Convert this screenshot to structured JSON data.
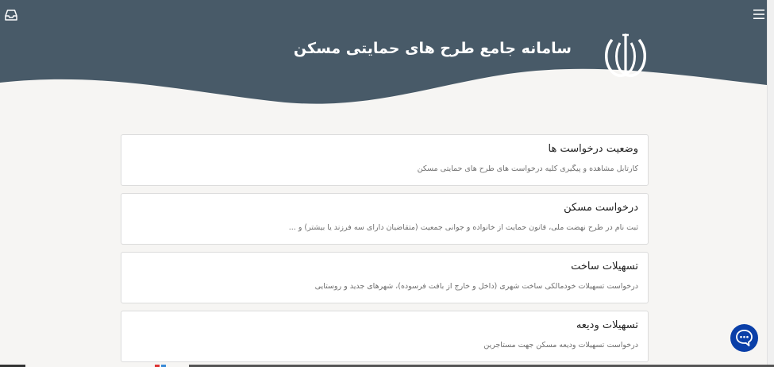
{
  "header": {
    "title": "سامانه جامع طرح های حمایتی مسکن",
    "emblem_icon": "iran-emblem-icon",
    "menu_icon": "hamburger-menu-icon",
    "inbox_icon": "inbox-tray-icon",
    "background_color": "#485a68"
  },
  "cards": [
    {
      "title": "وضعیت درخواست ها",
      "description": "کارتابل مشاهده و پیگیری کلیه درخواست های طرح های حمایتی مسکن"
    },
    {
      "title": "درخواست مسکن",
      "description": "ثبت نام در طرح نهضت ملی، قانون حمایت از خانواده و جوانی جمعیت (متقاضیان دارای سه فرزند یا بیشتر) و ..."
    },
    {
      "title": "تسهیلات ساخت",
      "description": "درخواست تسهیلات خودمالکی ساخت شهری (داخل و خارج از بافت فرسوده)، شهرهای جدید و روستایی"
    },
    {
      "title": "تسهیلات ودیعه",
      "description": "درخواست تسهیلات ودیعه مسکن جهت مستاجرین"
    }
  ],
  "chat": {
    "icon": "chat-bubble-icon",
    "color": "#0a3fa8"
  }
}
